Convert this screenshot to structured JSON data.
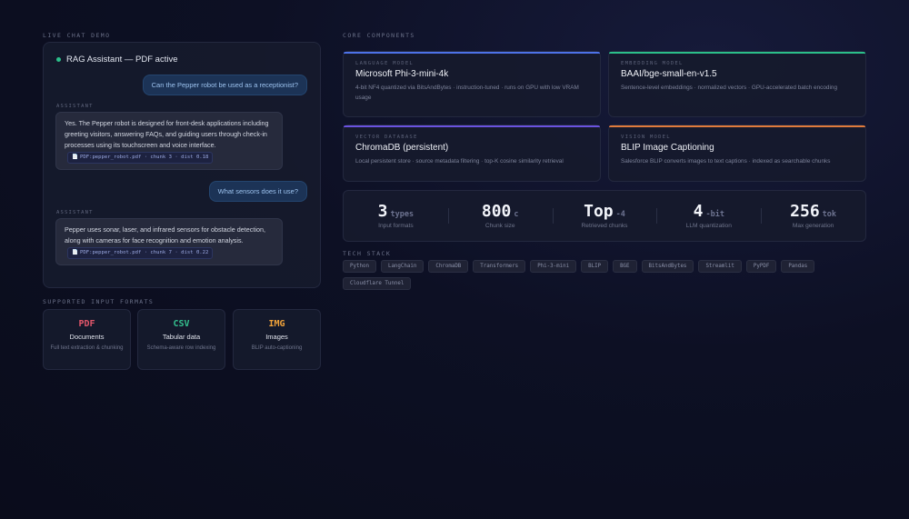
{
  "sections": {
    "live_chat": "LIVE CHAT DEMO",
    "core_components": "CORE COMPONENTS",
    "supported_formats": "SUPPORTED INPUT FORMATS",
    "tech_stack": "TECH STACK"
  },
  "chat": {
    "title": "RAG Assistant — PDF active",
    "messages": [
      {
        "role": "user",
        "text": "Can the Pepper robot be used as a receptionist?"
      },
      {
        "role": "assistant",
        "role_label": "ASSISTANT",
        "text": "Yes. The Pepper robot is designed for front-desk applications including greeting visitors, answering FAQs, and guiding users through check-in processes using its touchscreen and voice interface.",
        "citation": "PDF:pepper_robot.pdf · chunk 3 · dist 0.18"
      },
      {
        "role": "user",
        "text": "What sensors does it use?"
      },
      {
        "role": "assistant",
        "role_label": "ASSISTANT",
        "text": "Pepper uses sonar, laser, and infrared sensors for obstacle detection, along with cameras for face recognition and emotion analysis.",
        "citation": "PDF:pepper_robot.pdf · chunk 7 · dist 0.22"
      }
    ]
  },
  "formats": [
    {
      "code": "PDF",
      "name": "Documents",
      "desc": "Full text extraction & chunking",
      "color": "#e0566a"
    },
    {
      "code": "CSV",
      "name": "Tabular data",
      "desc": "Schema-aware row indexing",
      "color": "#34c08e"
    },
    {
      "code": "IMG",
      "name": "Images",
      "desc": "BLIP auto-captioning",
      "color": "#f0a23a"
    }
  ],
  "components": [
    {
      "kicker": "LANGUAGE MODEL",
      "title": "Microsoft Phi-3-mini-4k",
      "desc": "4-bit NF4 quantized via BitsAndBytes · instruction-tuned · runs on GPU with low VRAM usage",
      "accent": "#4d72e8"
    },
    {
      "kicker": "EMBEDDING MODEL",
      "title": "BAAI/bge-small-en-v1.5",
      "desc": "Sentence-level embeddings · normalized vectors · GPU-accelerated batch encoding",
      "accent": "#2bbf8a"
    },
    {
      "kicker": "VECTOR DATABASE",
      "title": "ChromaDB (persistent)",
      "desc": "Local persistent store · source metadata filtering · top-K cosine similarity retrieval",
      "accent": "#6a52e0"
    },
    {
      "kicker": "VISION MODEL",
      "title": "BLIP Image Captioning",
      "desc": "Salesforce BLIP converts images to text captions · indexed as searchable chunks",
      "accent": "#e07a3c"
    }
  ],
  "stats": [
    {
      "value": "3",
      "unit": "types",
      "label": "Input formats"
    },
    {
      "value": "800",
      "unit": "c",
      "label": "Chunk size"
    },
    {
      "value": "Top",
      "unit": "-4",
      "label": "Retrieved chunks"
    },
    {
      "value": "4",
      "unit": "-bit",
      "label": "LLM quantization"
    },
    {
      "value": "256",
      "unit": "tok",
      "label": "Max generation"
    }
  ],
  "tech_stack": [
    "Python",
    "LangChain",
    "ChromaDB",
    "Transformers",
    "Phi-3-mini",
    "BLIP",
    "BGE",
    "BitsAndBytes",
    "Streamlit",
    "PyPDF",
    "Pandas",
    "Cloudflare Tunnel"
  ]
}
